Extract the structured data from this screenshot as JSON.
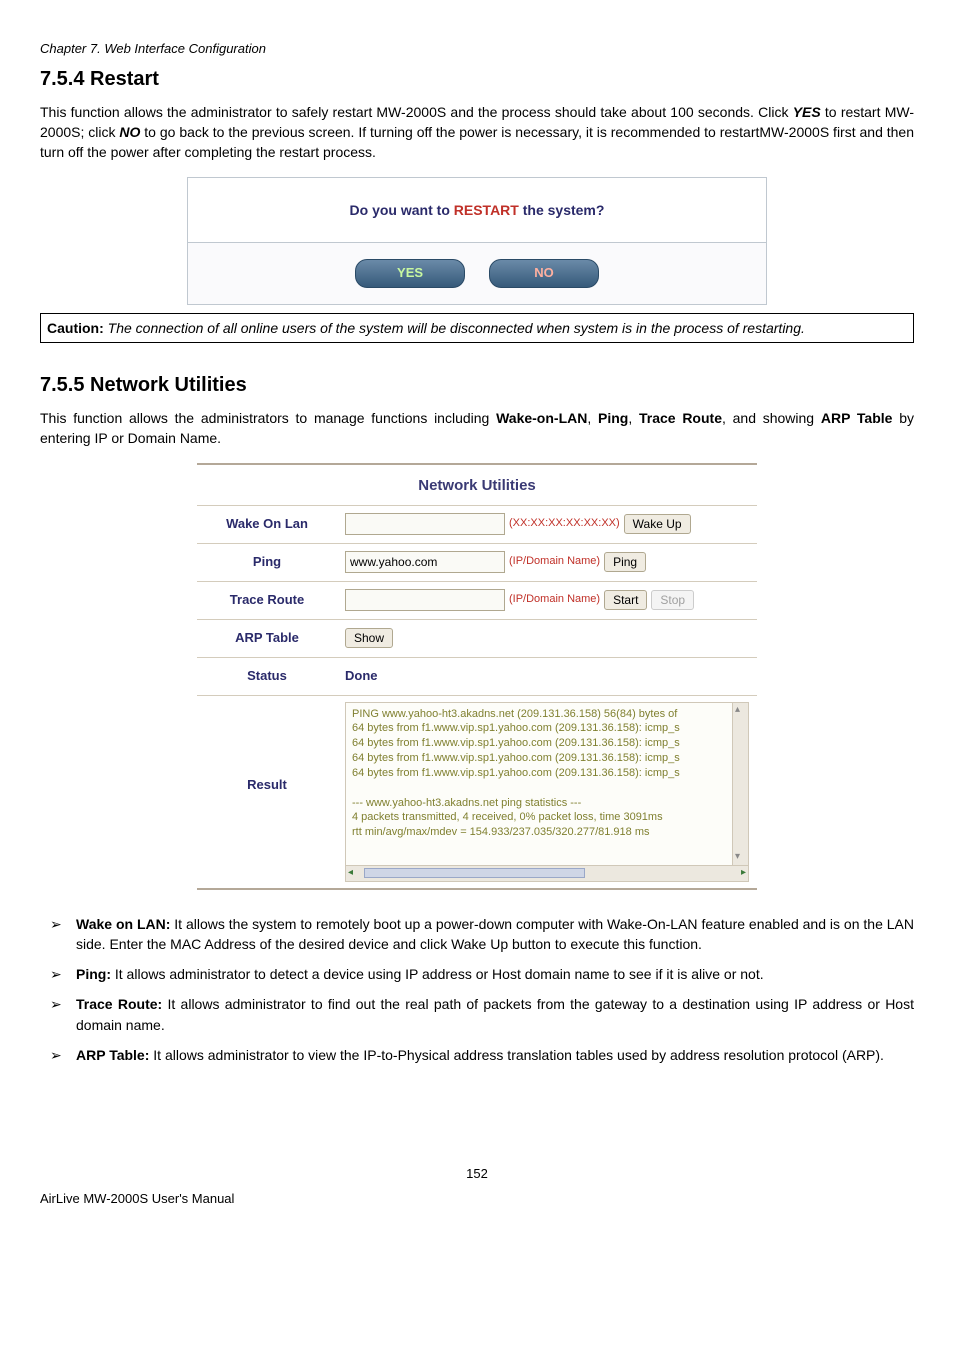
{
  "chapter_header": "Chapter 7.    Web Interface Configuration",
  "s754": {
    "heading": "7.5.4  Restart",
    "para_1a": "This function allows the administrator to safely restart MW-2000S and the process should take about 100 seconds. Click ",
    "para_1b": "YES",
    "para_1c": " to restart MW-2000S; click ",
    "para_1d": "NO",
    "para_1e": " to go back to the previous screen. If turning off the power is necessary, it is recommended to restartMW-2000S first and then turn off the power after completing the restart process.",
    "dialog_pre": "Do you want to ",
    "dialog_hl": "RESTART",
    "dialog_post": " the system?",
    "btn_yes": "YES",
    "btn_no": "NO",
    "caution_label": "Caution:",
    "caution_body": " The connection of all online users of the system will be disconnected when system is in the process of restarting."
  },
  "s755": {
    "heading": "7.5.5  Network Utilities",
    "intro_a": "This function allows the administrators to manage functions including ",
    "intro_b": "Wake-on-LAN",
    "intro_c": ", ",
    "intro_d": "Ping",
    "intro_e": ", ",
    "intro_f": "Trace Route",
    "intro_g": ", and showing ",
    "intro_h": "ARP Table",
    "intro_i": " by entering IP or Domain Name.",
    "nu_title": "Network Utilities",
    "row_wol": "Wake On Lan",
    "row_ping": "Ping",
    "row_trace": "Trace Route",
    "row_arp": "ARP Table",
    "row_status": "Status",
    "row_result": "Result",
    "hint_mac": "(XX:XX:XX:XX:XX:XX)",
    "hint_ip": "(IP/Domain Name)",
    "btn_wakeup": "Wake Up",
    "btn_ping": "Ping",
    "btn_start": "Start",
    "btn_stop": "Stop",
    "btn_show": "Show",
    "ping_value": "www.yahoo.com",
    "status_val": "Done",
    "result_text": "PING www.yahoo-ht3.akadns.net (209.131.36.158) 56(84) bytes of\n64 bytes from f1.www.vip.sp1.yahoo.com (209.131.36.158): icmp_s\n64 bytes from f1.www.vip.sp1.yahoo.com (209.131.36.158): icmp_s\n64 bytes from f1.www.vip.sp1.yahoo.com (209.131.36.158): icmp_s\n64 bytes from f1.www.vip.sp1.yahoo.com (209.131.36.158): icmp_s\n\n--- www.yahoo-ht3.akadns.net ping statistics ---\n4 packets transmitted, 4 received, 0% packet loss, time 3091ms\nrtt min/avg/max/mdev = 154.933/237.035/320.277/81.918 ms",
    "feat_wol_t": "Wake on LAN:",
    "feat_wol_b": " It allows the system to remotely boot up a power-down computer with Wake-On-LAN feature enabled and is on the LAN side. Enter the MAC Address of the desired device and click Wake Up button to execute this function.",
    "feat_ping_t": "Ping:",
    "feat_ping_b": " It allows administrator to detect a device using IP address or Host domain name to see if it is alive or not.",
    "feat_trace_t": "Trace Route:",
    "feat_trace_b": " It allows administrator to find out the real path of packets from the gateway to a destination using IP address or Host domain name.",
    "feat_arp_t": "ARP Table:",
    "feat_arp_b": " It allows administrator to view the IP-to-Physical address translation tables used by address resolution protocol (ARP)."
  },
  "page_number": "152",
  "footer": "AirLive MW-2000S User's Manual"
}
